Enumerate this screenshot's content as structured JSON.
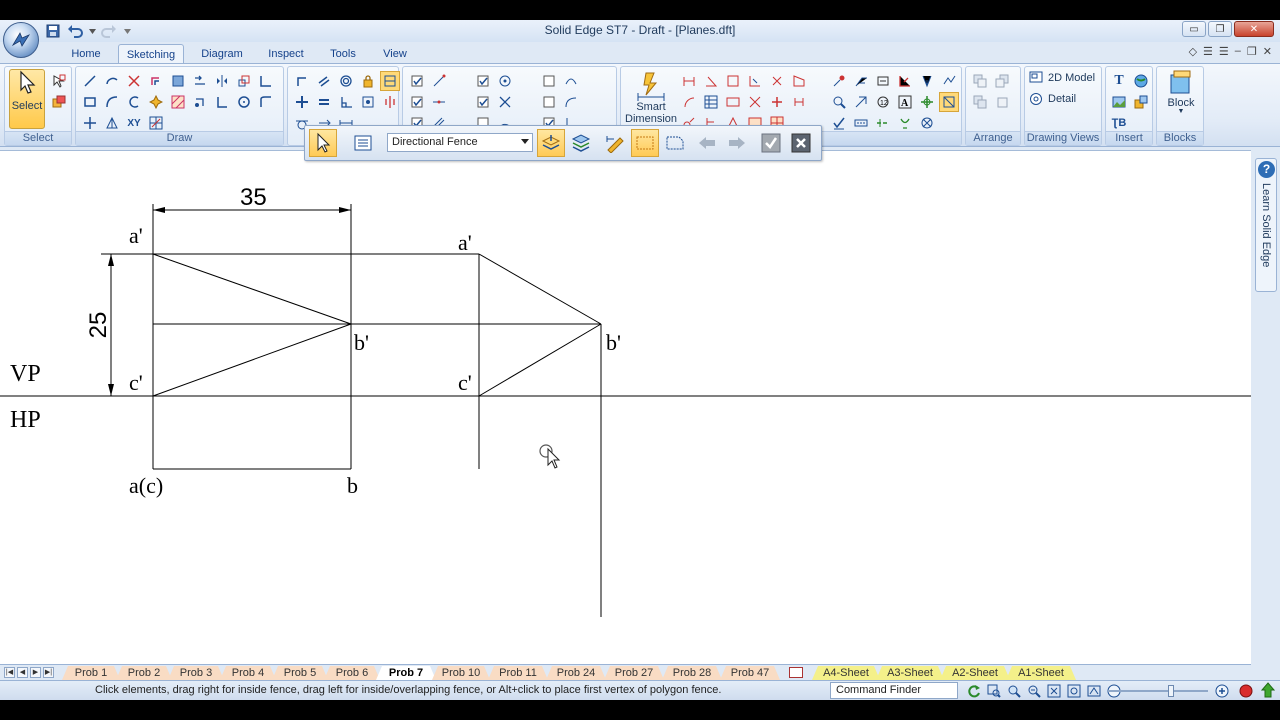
{
  "window": {
    "title": "Solid Edge ST7 - Draft - [Planes.dft]",
    "minimize_glyph": "▭",
    "restore_glyph": "❐",
    "close_glyph": "✕"
  },
  "tabs": [
    {
      "label": "Home"
    },
    {
      "label": "Sketching",
      "active": true
    },
    {
      "label": "Diagram"
    },
    {
      "label": "Inspect"
    },
    {
      "label": "Tools"
    },
    {
      "label": "View"
    }
  ],
  "ribbon": {
    "select_group": {
      "button_label": "Select",
      "group_label": "Select"
    },
    "draw_group": {
      "group_label": "Draw"
    },
    "annotation_group": {
      "group_label": "Annotation",
      "smart_dimension_label": "Smart Dimension"
    },
    "arrange_group": {
      "group_label": "Arrange"
    },
    "drawing_views_group": {
      "group_label": "Drawing Views",
      "model_2d_label": "2D Model",
      "detail_label": "Detail"
    },
    "insert_group": {
      "group_label": "Insert"
    },
    "blocks_group": {
      "group_label": "Blocks",
      "block_label": "Block"
    }
  },
  "command_bar": {
    "fence_mode": "Directional Fence"
  },
  "drawing": {
    "dimension_horizontal": "35",
    "dimension_vertical": "25",
    "label_VP": "VP",
    "label_HP": "HP",
    "front_view": {
      "a_prime": "a'",
      "b_prime": "b'",
      "c_prime": "c'"
    },
    "top_view": {
      "ac": "a(c)",
      "b": "b"
    },
    "side_view": {
      "a_prime": "a'",
      "b_prime": "b'",
      "c_prime": "c'"
    }
  },
  "learn_panel": {
    "help_glyph": "?",
    "label": "Learn Solid Edge"
  },
  "sheet_tabs": [
    {
      "label": "Prob 1"
    },
    {
      "label": "Prob 2"
    },
    {
      "label": "Prob 3"
    },
    {
      "label": "Prob 4"
    },
    {
      "label": "Prob 5"
    },
    {
      "label": "Prob 6"
    },
    {
      "label": "Prob 7",
      "active": true
    },
    {
      "label": "Prob 10"
    },
    {
      "label": "Prob 11"
    },
    {
      "label": "Prob 24"
    },
    {
      "label": "Prob 27"
    },
    {
      "label": "Prob 28"
    },
    {
      "label": "Prob 47"
    }
  ],
  "background_sheet_tabs": [
    {
      "label": "A4-Sheet"
    },
    {
      "label": "A3-Sheet"
    },
    {
      "label": "A2-Sheet"
    },
    {
      "label": "A1-Sheet"
    }
  ],
  "status": {
    "prompt": "Click elements, drag right for inside fence, drag left for inside/overlapping fence, or Alt+click to place first vertex of polygon fence.",
    "command_finder": "Command Finder"
  },
  "colors": {
    "accent_orange": "#ffc94a",
    "ribbon_blue": "#dfe9f5",
    "sheet_tab": "#f9dcc4",
    "background_sheet_tab": "#f4f08a"
  }
}
